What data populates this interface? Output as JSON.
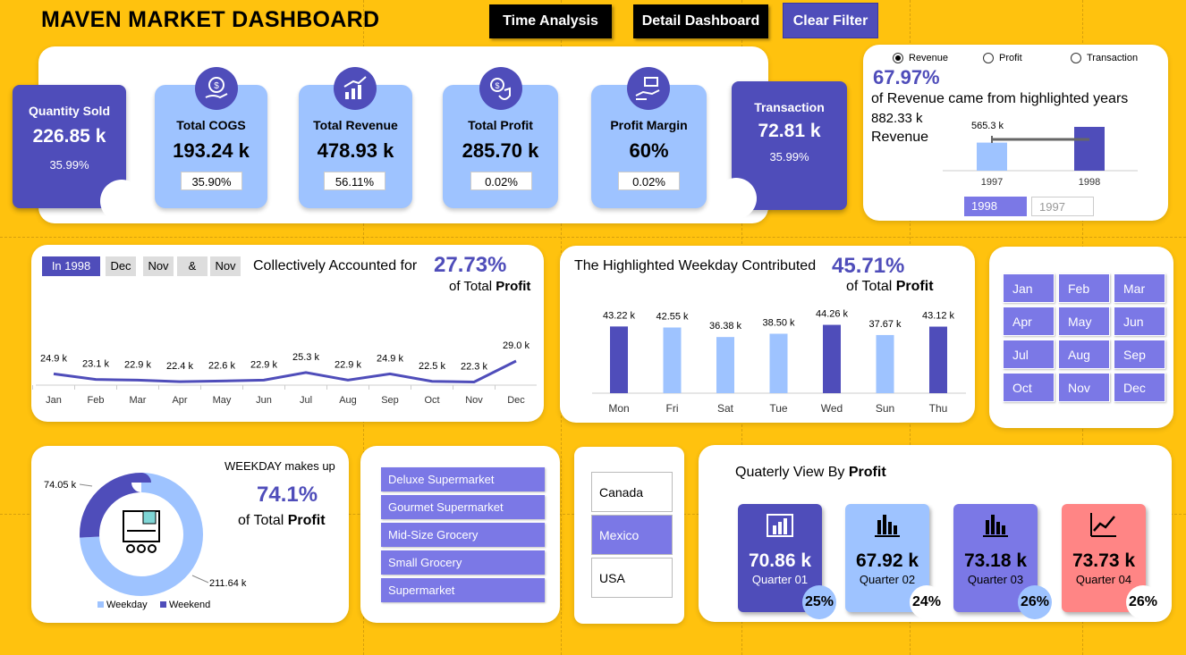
{
  "header": {
    "title": "MAVEN MARKET DASHBOARD",
    "time_analysis_label": "Time Analysis",
    "detail_dashboard_label": "Detail Dashboard",
    "clear_filter_label": "Clear Filter"
  },
  "kpis": {
    "quantity_sold": {
      "label": "Quantity Sold",
      "value": "226.85 k",
      "pct": "35.99%"
    },
    "total_cogs": {
      "label": "Total COGS",
      "value": "193.24 k",
      "pct": "35.90%"
    },
    "total_revenue": {
      "label": "Total Revenue",
      "value": "478.93 k",
      "pct": "56.11%"
    },
    "total_profit": {
      "label": "Total Profit",
      "value": "285.70 k",
      "pct": "0.02%"
    },
    "profit_margin": {
      "label": "Profit Margin",
      "value": "60%",
      "pct": "0.02%"
    },
    "transaction": {
      "label": "Transaction",
      "value": "72.81 k",
      "pct": "35.99%"
    }
  },
  "year_panel": {
    "radios": [
      "Revenue",
      "Profit",
      "Transaction"
    ],
    "selected_radio": "Revenue",
    "pct": "67.97%",
    "desc": "of Revenue came from highlighted years",
    "total_value": "882.33 k",
    "total_label": "Revenue",
    "bar_label_1997": "565.3 k",
    "years": [
      "1997",
      "1998"
    ],
    "year_values": [
      565.3,
      882.33
    ],
    "slicer_selected": "1998",
    "slicer_other": "1997"
  },
  "monthly_panel": {
    "chips": [
      "In 1998",
      "Dec",
      "Nov",
      "&",
      "Nov"
    ],
    "headline": "Collectively Accounted for",
    "pct": "27.73%",
    "sub_prefix": "of Total",
    "sub_bold": "Profit"
  },
  "weekday_panel": {
    "headline": "The Highlighted Weekday Contributed",
    "pct": "45.71%",
    "sub_prefix": "of Total",
    "sub_bold": "Profit"
  },
  "months_slicer": [
    "Jan",
    "Feb",
    "Mar",
    "Apr",
    "May",
    "Jun",
    "Jul",
    "Aug",
    "Sep",
    "Oct",
    "Nov",
    "Dec"
  ],
  "donut_panel": {
    "headline": "WEEKDAY makes up",
    "pct": "74.1%",
    "sub_prefix": "of Total",
    "sub_bold": "Profit",
    "label_weekend": "74.05 k",
    "label_weekday": "211.64 k",
    "legend": [
      "Weekday",
      "Weekend"
    ]
  },
  "store_types": [
    "Deluxe Supermarket",
    "Gourmet Supermarket",
    "Mid-Size Grocery",
    "Small Grocery",
    "Supermarket"
  ],
  "countries": [
    "Canada",
    "Mexico",
    "USA"
  ],
  "selected_country": "Mexico",
  "quarterly": {
    "title_prefix": "Quaterly View By",
    "title_bold": "Profit",
    "cards": [
      {
        "value": "70.86 k",
        "label": "Quarter 01",
        "pct": "25%",
        "color": "#4F4DBA",
        "icon": "bar-chart-icon"
      },
      {
        "value": "67.92 k",
        "label": "Quarter 02",
        "pct": "24%",
        "color": "#9EC3FF",
        "icon": "column-chart-icon"
      },
      {
        "value": "73.18 k",
        "label": "Quarter 03",
        "pct": "26%",
        "color": "#7B78E6",
        "icon": "column-chart-icon"
      },
      {
        "value": "73.73 k",
        "label": "Quarter 04",
        "pct": "26%",
        "color": "#FF8585",
        "icon": "trend-chart-icon"
      }
    ]
  },
  "colors": {
    "background": "#FFC20E",
    "dark_purple": "#4F4DBA",
    "light_blue": "#9EC3FF",
    "mid_purple": "#7B78E6",
    "coral": "#FF8585"
  },
  "chart_data": [
    {
      "type": "line",
      "categories": [
        "Jan",
        "Feb",
        "Mar",
        "Apr",
        "May",
        "Jun",
        "Jul",
        "Aug",
        "Sep",
        "Oct",
        "Nov",
        "Dec"
      ],
      "values": [
        24.9,
        23.1,
        22.9,
        22.4,
        22.6,
        22.9,
        25.3,
        22.9,
        24.9,
        22.5,
        22.3,
        29.0
      ],
      "data_labels": [
        "24.9 k",
        "23.1 k",
        "22.9 k",
        "22.4 k",
        "22.6 k",
        "22.9 k",
        "25.3 k",
        "22.9 k",
        "24.9 k",
        "22.5 k",
        "22.3 k",
        "29.0 k"
      ],
      "title": "",
      "xlabel": "",
      "ylabel": ""
    },
    {
      "type": "bar",
      "categories": [
        "Mon",
        "Fri",
        "Sat",
        "Tue",
        "Wed",
        "Sun",
        "Thu"
      ],
      "values": [
        43.22,
        42.55,
        36.38,
        38.5,
        44.26,
        37.67,
        43.12
      ],
      "data_labels": [
        "43.22 k",
        "42.55 k",
        "36.38 k",
        "38.50 k",
        "44.26 k",
        "37.67 k",
        "43.12 k"
      ],
      "highlighted": [
        true,
        false,
        false,
        false,
        true,
        false,
        true
      ],
      "title": "",
      "xlabel": "",
      "ylabel": ""
    },
    {
      "type": "pie",
      "categories": [
        "Weekday",
        "Weekend"
      ],
      "values": [
        211.64,
        74.05
      ],
      "data_labels": [
        "211.64 k",
        "74.05 k"
      ],
      "colors": [
        "#9EC3FF",
        "#4F4DBA"
      ]
    },
    {
      "type": "bar",
      "categories": [
        "1997",
        "1998"
      ],
      "values": [
        565.3,
        882.33
      ],
      "data_labels": [
        "565.3 k",
        ""
      ],
      "colors": [
        "#9EC3FF",
        "#4F4DBA"
      ]
    }
  ]
}
